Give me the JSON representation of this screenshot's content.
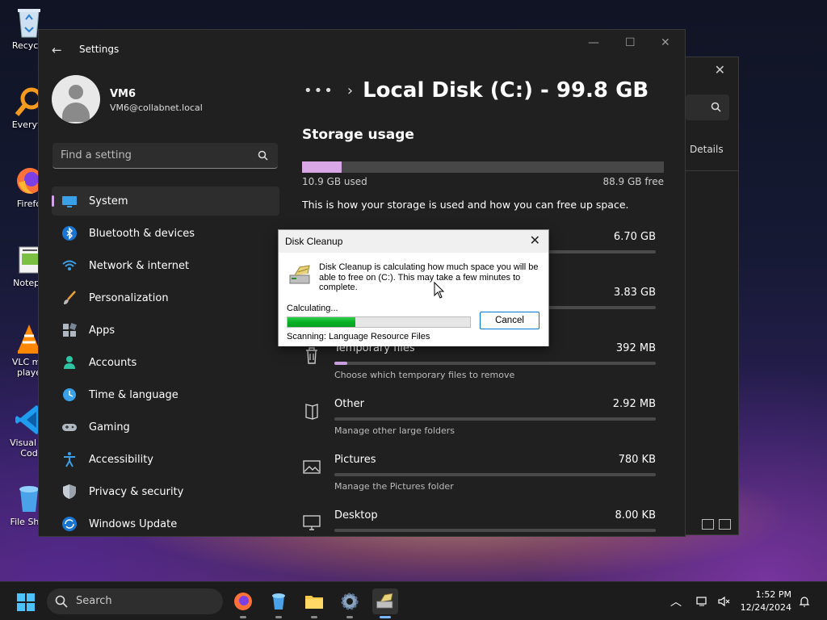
{
  "desktop": {
    "icons": [
      {
        "label": "Recycle",
        "icon": "recycle-bin-icon"
      },
      {
        "label": "Everyth",
        "icon": "everything-search-icon"
      },
      {
        "label": "Firefo",
        "icon": "firefox-icon"
      },
      {
        "label": "Notepa",
        "icon": "notepad-icon"
      },
      {
        "label": "VLC me",
        "label2": "playe",
        "icon": "vlc-icon"
      },
      {
        "label": "Visual St",
        "label2": "Cod",
        "icon": "vscode-icon"
      },
      {
        "label": "File Shre",
        "icon": "file-shredder-icon"
      }
    ]
  },
  "bg_window": {
    "close": "✕",
    "details": "Details"
  },
  "settings": {
    "title": "Settings",
    "profile": {
      "name": "VM6",
      "email": "VM6@collabnet.local"
    },
    "search_placeholder": "Find a setting",
    "nav": [
      {
        "label": "System",
        "icon": "system-icon",
        "active": true
      },
      {
        "label": "Bluetooth & devices",
        "icon": "bluetooth-icon"
      },
      {
        "label": "Network & internet",
        "icon": "network-icon"
      },
      {
        "label": "Personalization",
        "icon": "personalization-icon"
      },
      {
        "label": "Apps",
        "icon": "apps-icon"
      },
      {
        "label": "Accounts",
        "icon": "accounts-icon"
      },
      {
        "label": "Time & language",
        "icon": "time-language-icon"
      },
      {
        "label": "Gaming",
        "icon": "gaming-icon"
      },
      {
        "label": "Accessibility",
        "icon": "accessibility-icon"
      },
      {
        "label": "Privacy & security",
        "icon": "privacy-icon"
      },
      {
        "label": "Windows Update",
        "icon": "windows-update-icon"
      }
    ],
    "breadcrumb": {
      "ellipsis": "•••",
      "chevron": "›",
      "title": "Local Disk (C:) - 99.8 GB"
    },
    "storage": {
      "heading": "Storage usage",
      "used_fraction": 0.109,
      "used_label": "10.9 GB used",
      "free_label": "88.9 GB free",
      "description": "This is how your storage is used and how you can free up space.",
      "categories": [
        {
          "name": "",
          "size": "6.70 GB",
          "desc": "",
          "fraction": 0.55,
          "icon": "apps-category-icon"
        },
        {
          "name": "",
          "size": "3.83 GB",
          "desc": "",
          "fraction": 0.32,
          "icon": "system-category-icon"
        },
        {
          "name": "Temporary files",
          "size": "392 MB",
          "desc": "Choose which temporary files to remove",
          "fraction": 0.04,
          "icon": "trash-icon"
        },
        {
          "name": "Other",
          "size": "2.92 MB",
          "desc": "Manage other large folders",
          "fraction": 0.0,
          "icon": "folder-icon"
        },
        {
          "name": "Pictures",
          "size": "780 KB",
          "desc": "Manage the Pictures folder",
          "fraction": 0.0,
          "icon": "pictures-icon"
        },
        {
          "name": "Desktop",
          "size": "8.00 KB",
          "desc": "",
          "fraction": 0.0,
          "icon": "desktop-icon"
        }
      ]
    }
  },
  "dialog": {
    "title": "Disk Cleanup",
    "close": "✕",
    "message": "Disk Cleanup is calculating how much space you will be able to free on  (C:). This may take a few minutes to complete.",
    "calculating": "Calculating...",
    "progress_fraction": 0.37,
    "cancel": "Cancel",
    "scanning": "Scanning:   Language Resource Files"
  },
  "taskbar": {
    "search": "Search",
    "time": "1:52 PM",
    "date": "12/24/2024",
    "apps": [
      "firefox-icon",
      "file-shredder-icon",
      "file-explorer-icon",
      "settings-icon",
      "disk-cleanup-icon"
    ]
  }
}
